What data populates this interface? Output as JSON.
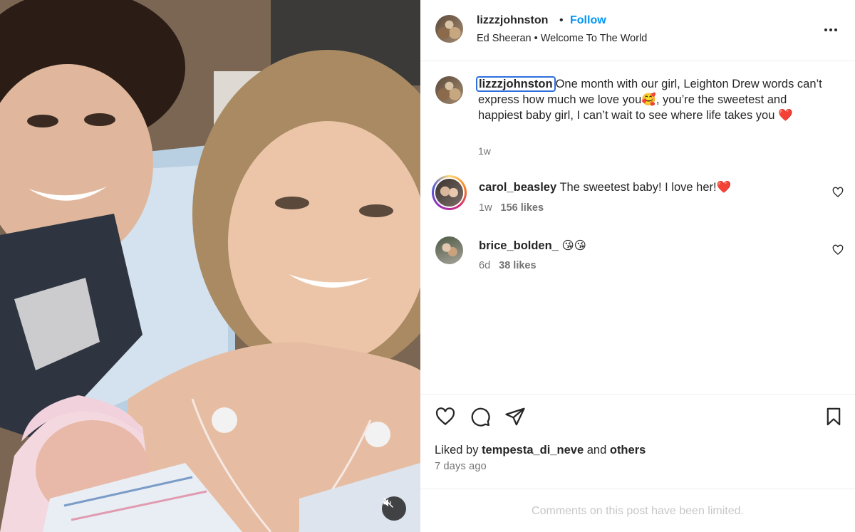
{
  "header": {
    "username": "lizzzjohnston",
    "dot": "•",
    "follow_label": "Follow",
    "audio": "Ed Sheeran • Welcome To The World",
    "more_icon": "more-horizontal-icon"
  },
  "caption": {
    "username": "lizzzjohnston",
    "text": "One month with our girl, Leighton Drew words can’t express how much we love you🥰, you’re the sweetest and happiest baby girl, I can’t wait to see where life takes you ❤️",
    "time": "1w"
  },
  "comments": [
    {
      "username": "carol_beasley",
      "text": "The sweetest baby! I love her!❤️",
      "time": "1w",
      "likes": "156 likes",
      "has_story": true
    },
    {
      "username": "brice_bolden_",
      "text": "😘😘",
      "time": "6d",
      "likes": "38 likes",
      "has_story": false
    }
  ],
  "actions": {
    "liked_prefix": "Liked by",
    "liked_user": "tempesta_di_neve",
    "liked_and": "and",
    "liked_others": "others",
    "date": "7 days ago",
    "comments_limited": "Comments on this post have been limited."
  },
  "colors": {
    "accent": "#0095f6",
    "text": "#262626",
    "secondary": "#737373",
    "muted": "#c7c7c7"
  }
}
